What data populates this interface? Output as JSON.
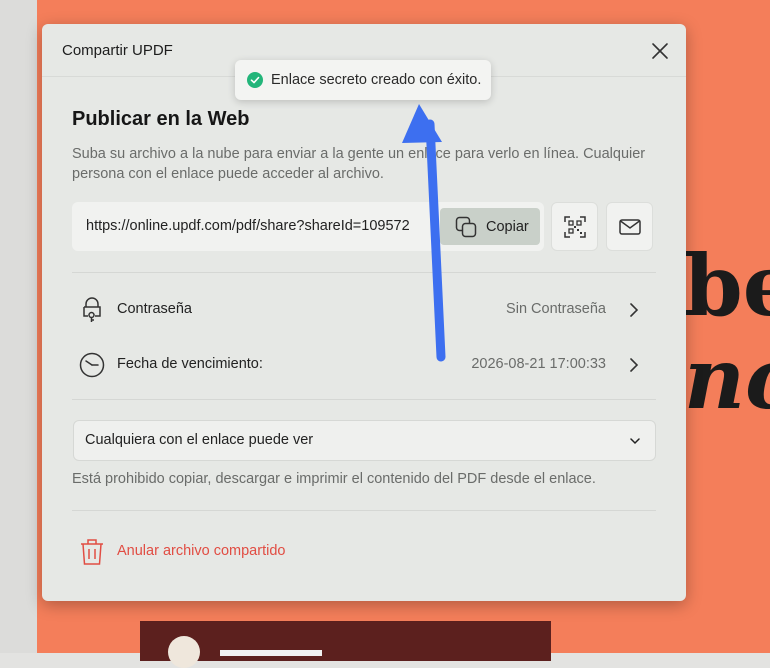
{
  "dialog": {
    "title": "Compartir UPDF",
    "close_icon": "close-icon"
  },
  "toast": {
    "message": "Enlace secreto creado con éxito.",
    "icon": "check-circle-icon",
    "color": "#22b57a"
  },
  "publish": {
    "title": "Publicar en la Web",
    "description": "Suba su archivo a la nube para enviar a la gente un enlace para verlo en línea. Cualquier persona con el enlace puede acceder al archivo.",
    "link": "https://online.updf.com/pdf/share?shareId=109572",
    "copy_label": "Copiar",
    "qr_icon": "qr-code-icon",
    "mail_icon": "mail-icon"
  },
  "settings": {
    "password_label": "Contraseña",
    "password_value": "Sin Contraseña",
    "expiration_label": "Fecha de vencimiento:",
    "expiration_value": "2026-08-21 17:00:33"
  },
  "permission": {
    "selected": "Cualquiera con el enlace puede ver",
    "note": "Está prohibido copiar, descargar e imprimir el contenido del PDF desde el enlace."
  },
  "revoke": {
    "label": "Anular archivo compartido",
    "color": "#e14d43"
  },
  "background": {
    "text_line_1": "be",
    "text_line_2": "nc",
    "accent": "#f47e5a"
  },
  "annotation": {
    "arrow_color": "#3d6ff0"
  }
}
